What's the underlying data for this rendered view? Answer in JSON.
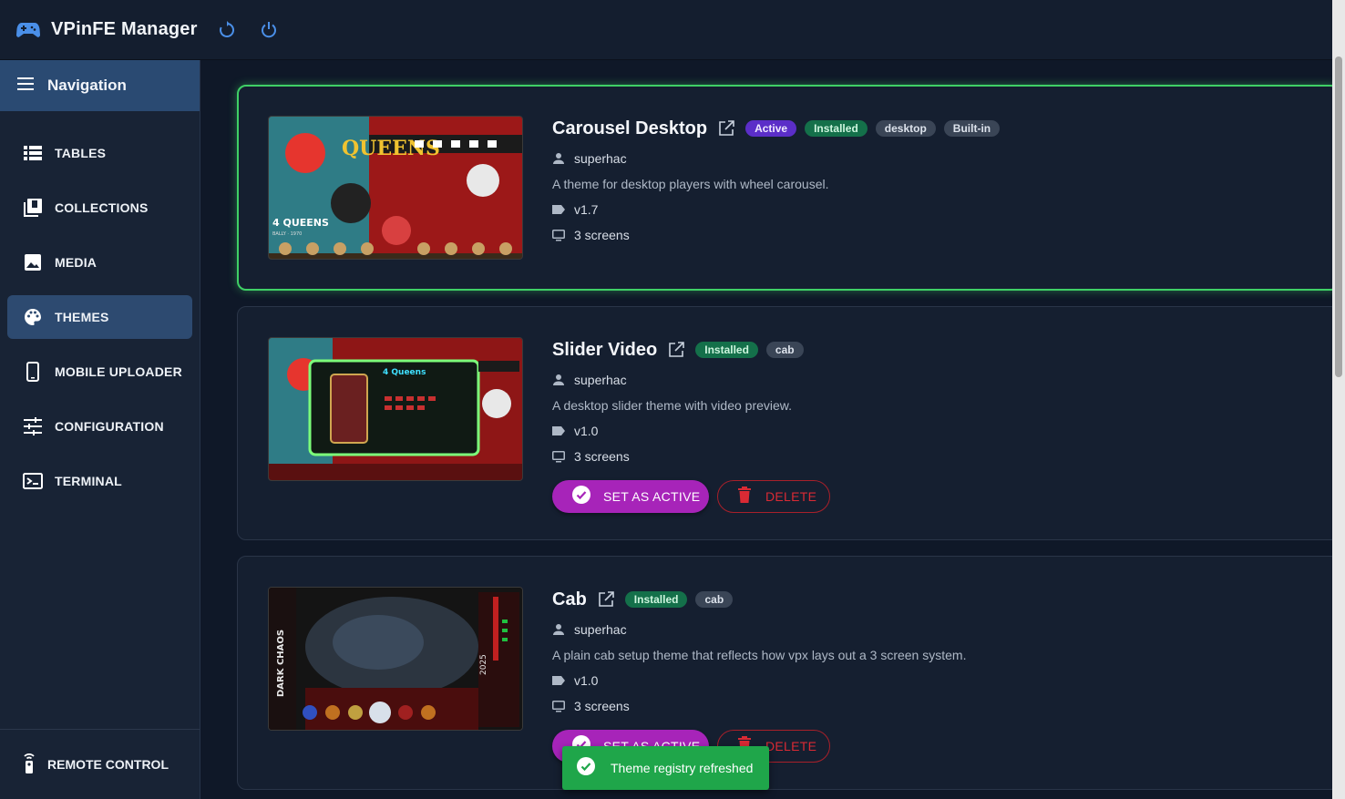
{
  "app": {
    "title": "VPinFE Manager"
  },
  "sidebar": {
    "header_label": "Navigation",
    "items": [
      {
        "label": "TABLES",
        "icon": "list-icon"
      },
      {
        "label": "COLLECTIONS",
        "icon": "library-icon"
      },
      {
        "label": "MEDIA",
        "icon": "image-icon"
      },
      {
        "label": "THEMES",
        "icon": "palette-icon",
        "active": true
      },
      {
        "label": "MOBILE UPLOADER",
        "icon": "phone-icon"
      },
      {
        "label": "CONFIGURATION",
        "icon": "tune-icon"
      },
      {
        "label": "TERMINAL",
        "icon": "terminal-icon"
      }
    ],
    "bottom": {
      "label": "REMOTE CONTROL",
      "icon": "remote-icon"
    }
  },
  "themes": [
    {
      "title": "Carousel Desktop",
      "active": true,
      "chips": [
        "Active",
        "Installed",
        "desktop",
        "Built-in"
      ],
      "author": "superhac",
      "description": "A theme for desktop players with wheel carousel.",
      "version": "v1.7",
      "screens": "3 screens",
      "thumb_text": [
        "QUEENS",
        "4 QUEENS",
        "BALLY · 1970"
      ]
    },
    {
      "title": "Slider Video",
      "active": false,
      "chips": [
        "Installed",
        "cab"
      ],
      "author": "superhac",
      "description": "A desktop slider theme with video preview.",
      "version": "v1.0",
      "screens": "3 screens",
      "thumb_text": [
        "4 Queens"
      ],
      "set_active_label": "SET AS ACTIVE",
      "delete_label": "DELETE"
    },
    {
      "title": "Cab",
      "active": false,
      "chips": [
        "Installed",
        "cab"
      ],
      "author": "superhac",
      "description": "A plain cab setup theme that reflects how vpx lays out a 3 screen system.",
      "version": "v1.0",
      "screens": "3 screens",
      "thumb_text": [
        "DARK CHAOS",
        "2025"
      ],
      "set_active_label": "SET AS ACTIVE",
      "delete_label": "DELETE"
    }
  ],
  "toast": {
    "message": "Theme registry refreshed"
  },
  "colors": {
    "accent": "#a724b9",
    "active_border": "#3fd066",
    "installed_chip": "#14704a",
    "active_chip": "#5b2ec8",
    "delete": "#d92a34",
    "toast": "#1fa64a"
  }
}
